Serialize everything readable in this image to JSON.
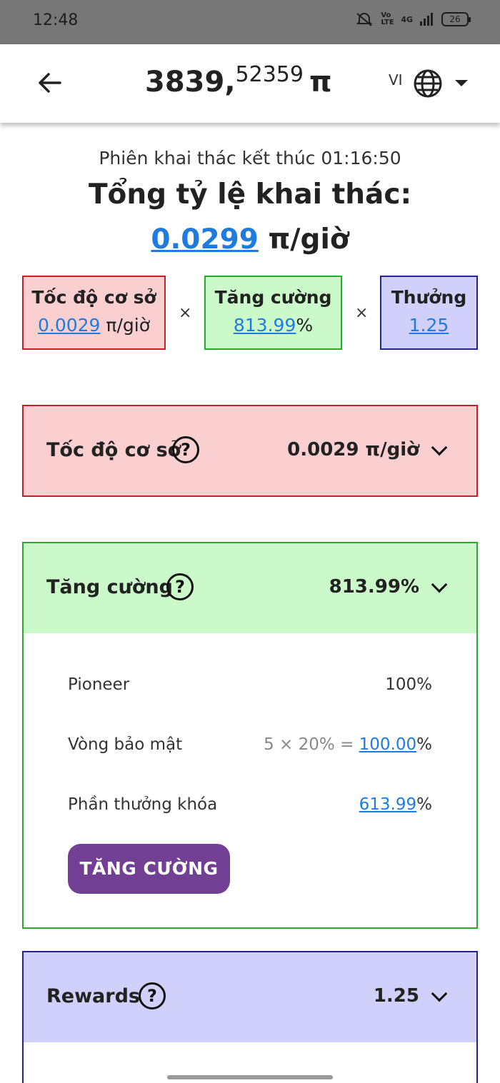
{
  "status_bar": {
    "time": "12:48",
    "network": "4G",
    "volte": "Vo LTE",
    "battery": "26"
  },
  "header": {
    "balance_int": "3839,",
    "balance_dec": "52359",
    "pi_symbol": "π",
    "language": "VI",
    "icons": [
      "arrow-left-icon",
      "globe-icon",
      "caret-down-icon"
    ]
  },
  "summary": {
    "session_text": "Phiên khai thác kết thúc 01:16:50",
    "total_title": "Tổng tỷ lệ khai thác:",
    "total_rate_value": "0.0299",
    "total_rate_unit": "π/giờ",
    "times_symbol": "×",
    "cards": {
      "base": {
        "title": "Tốc độ cơ sở",
        "value": "0.0029",
        "unit": "π/giờ"
      },
      "boost": {
        "title": "Tăng cường",
        "value": "813.99",
        "unit": "%"
      },
      "bonus": {
        "title": "Thưởng",
        "value": "1.25"
      }
    }
  },
  "sections": {
    "base": {
      "title": "Tốc độ cơ sở",
      "help": "?",
      "value": "0.0029 π/giờ"
    },
    "boost": {
      "title": "Tăng cường",
      "help": "?",
      "value": "813.99%",
      "rows": [
        {
          "label": "Pioneer",
          "value": "100%"
        },
        {
          "label": "Vòng bảo mật",
          "formula": "5 × 20% = ",
          "value": "100.00",
          "unit": "%"
        },
        {
          "label": "Phần thưởng khóa",
          "value": "613.99",
          "unit": "%"
        }
      ],
      "button_label": "TĂNG CƯỜNG"
    },
    "rewards": {
      "title": "Rewards",
      "help": "?",
      "value": "1.25"
    }
  },
  "colors": {
    "base_bg": "#f9cfd0",
    "base_border": "#c91f2a",
    "boost_bg": "#cbf9c9",
    "boost_border": "#2aa830",
    "bonus_bg": "#d0d0fb",
    "bonus_border": "#23238f",
    "link": "#1e7ce0",
    "button": "#713f94"
  }
}
